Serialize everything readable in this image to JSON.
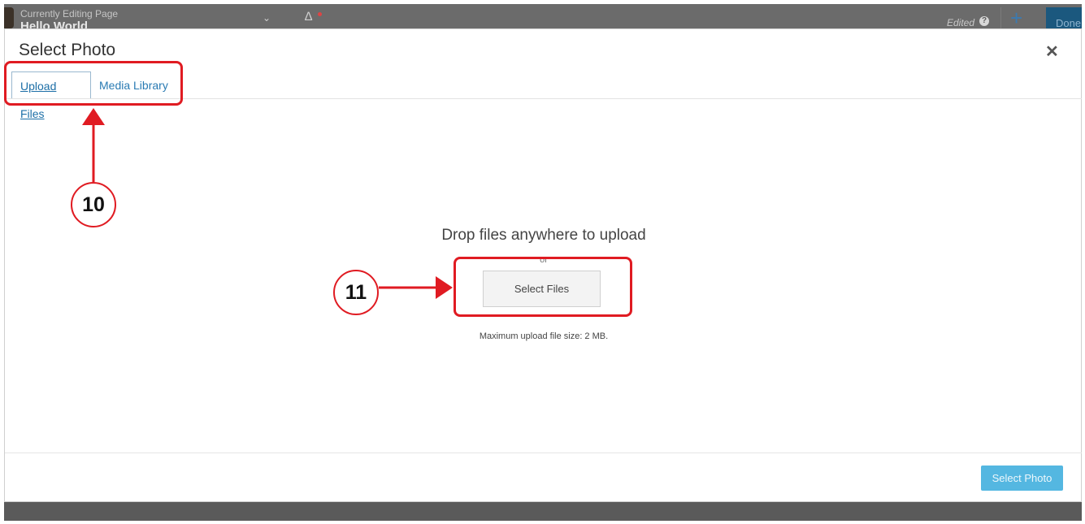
{
  "topbar": {
    "editing_label": "Currently Editing Page",
    "editing_title": "Hello World",
    "edited_label": "Edited",
    "done_label": "Done"
  },
  "modal": {
    "title": "Select Photo",
    "tabs": [
      {
        "label": "Upload Files",
        "active": true
      },
      {
        "label": "Media Library",
        "active": false
      }
    ],
    "drop_text": "Drop files anywhere to upload",
    "or_text": "or",
    "select_files_label": "Select Files",
    "max_size_text": "Maximum upload file size: 2 MB.",
    "select_photo_label": "Select Photo"
  },
  "annotations": [
    {
      "number": "10"
    },
    {
      "number": "11"
    }
  ],
  "colors": {
    "accent": "#1ca0d8",
    "annotation": "#e01b22",
    "tab_link": "#2a7bb3"
  }
}
